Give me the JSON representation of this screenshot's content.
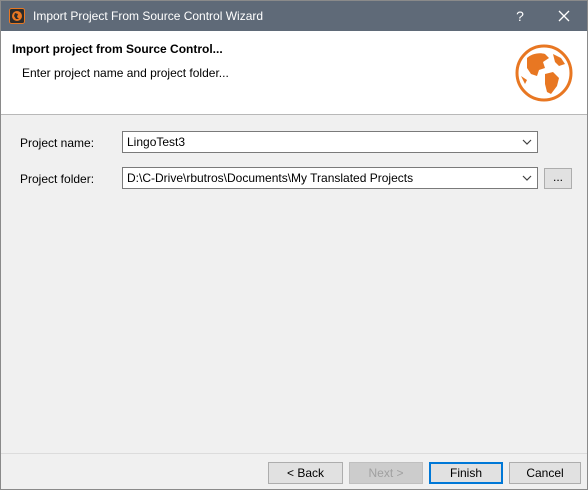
{
  "window": {
    "title": "Import Project From Source Control Wizard",
    "help_glyph": "?",
    "colors": {
      "titlebar": "#5f6a78",
      "globe": "#e87722",
      "default_button_border": "#0078d7"
    }
  },
  "header": {
    "title": "Import project from Source Control...",
    "subtitle": "Enter project name and project folder..."
  },
  "form": {
    "project_name_label": "Project name:",
    "project_name_value": "LingoTest3",
    "project_folder_label": "Project folder:",
    "project_folder_value": "D:\\C-Drive\\rbutros\\Documents\\My Translated Projects",
    "browse_label": "..."
  },
  "footer": {
    "back_label": "< Back",
    "next_label": "Next >",
    "finish_label": "Finish",
    "cancel_label": "Cancel"
  }
}
